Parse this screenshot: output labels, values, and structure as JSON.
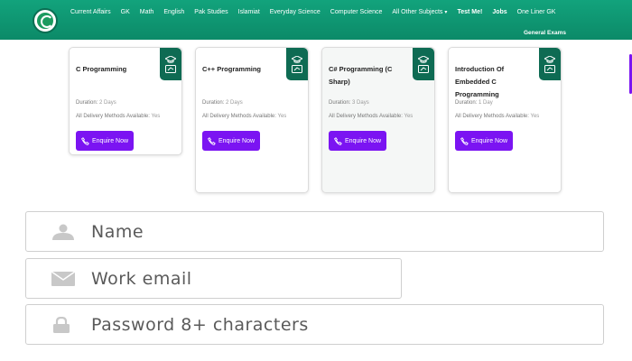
{
  "brand": {
    "logo_icon": "globe-logo-icon",
    "accent": "#0c8a68"
  },
  "nav": {
    "links": [
      {
        "label": "Current Affairs",
        "bold": false
      },
      {
        "label": "GK",
        "bold": false
      },
      {
        "label": "Math",
        "bold": false
      },
      {
        "label": "English",
        "bold": false
      },
      {
        "label": "Pak Studies",
        "bold": false
      },
      {
        "label": "Islamiat",
        "bold": false
      },
      {
        "label": "Everyday Science",
        "bold": false
      },
      {
        "label": "Computer Science",
        "bold": false
      },
      {
        "label": "All Other Subjects",
        "bold": false
      },
      {
        "label": "Test Me!",
        "bold": true
      },
      {
        "label": "Jobs",
        "bold": true
      },
      {
        "label": "One Liner GK",
        "bold": false
      }
    ],
    "secondary_label": "General Exams"
  },
  "courses": [
    {
      "title": "C Programming",
      "duration_label": "Duration:",
      "duration": "2 Days",
      "delivery_label": "All Delivery Methods Available:",
      "delivery": "Yes",
      "button": "Enquire Now"
    },
    {
      "title": "C++ Programming",
      "duration_label": "Duration:",
      "duration": "2 Days",
      "delivery_label": "All Delivery Methods Available:",
      "delivery": "Yes",
      "button": "Enquire Now"
    },
    {
      "title": "C# Programming (C Sharp)",
      "duration_label": "Duration:",
      "duration": "3 Days",
      "delivery_label": "All Delivery Methods Available:",
      "delivery": "Yes",
      "button": "Enquire Now"
    },
    {
      "title": "Introduction Of Embedded C Programming",
      "duration_label": "Duration:",
      "duration": "1 Day",
      "delivery_label": "All Delivery Methods Available:",
      "delivery": "Yes",
      "button": "Enquire Now"
    }
  ],
  "form": {
    "name_placeholder": "Name",
    "email_placeholder": "Work email",
    "password_placeholder": "Password 8+ characters"
  },
  "colors": {
    "badge": "#0e6b53",
    "button": "#7b14f2",
    "field_border": "#cfcfcf"
  }
}
